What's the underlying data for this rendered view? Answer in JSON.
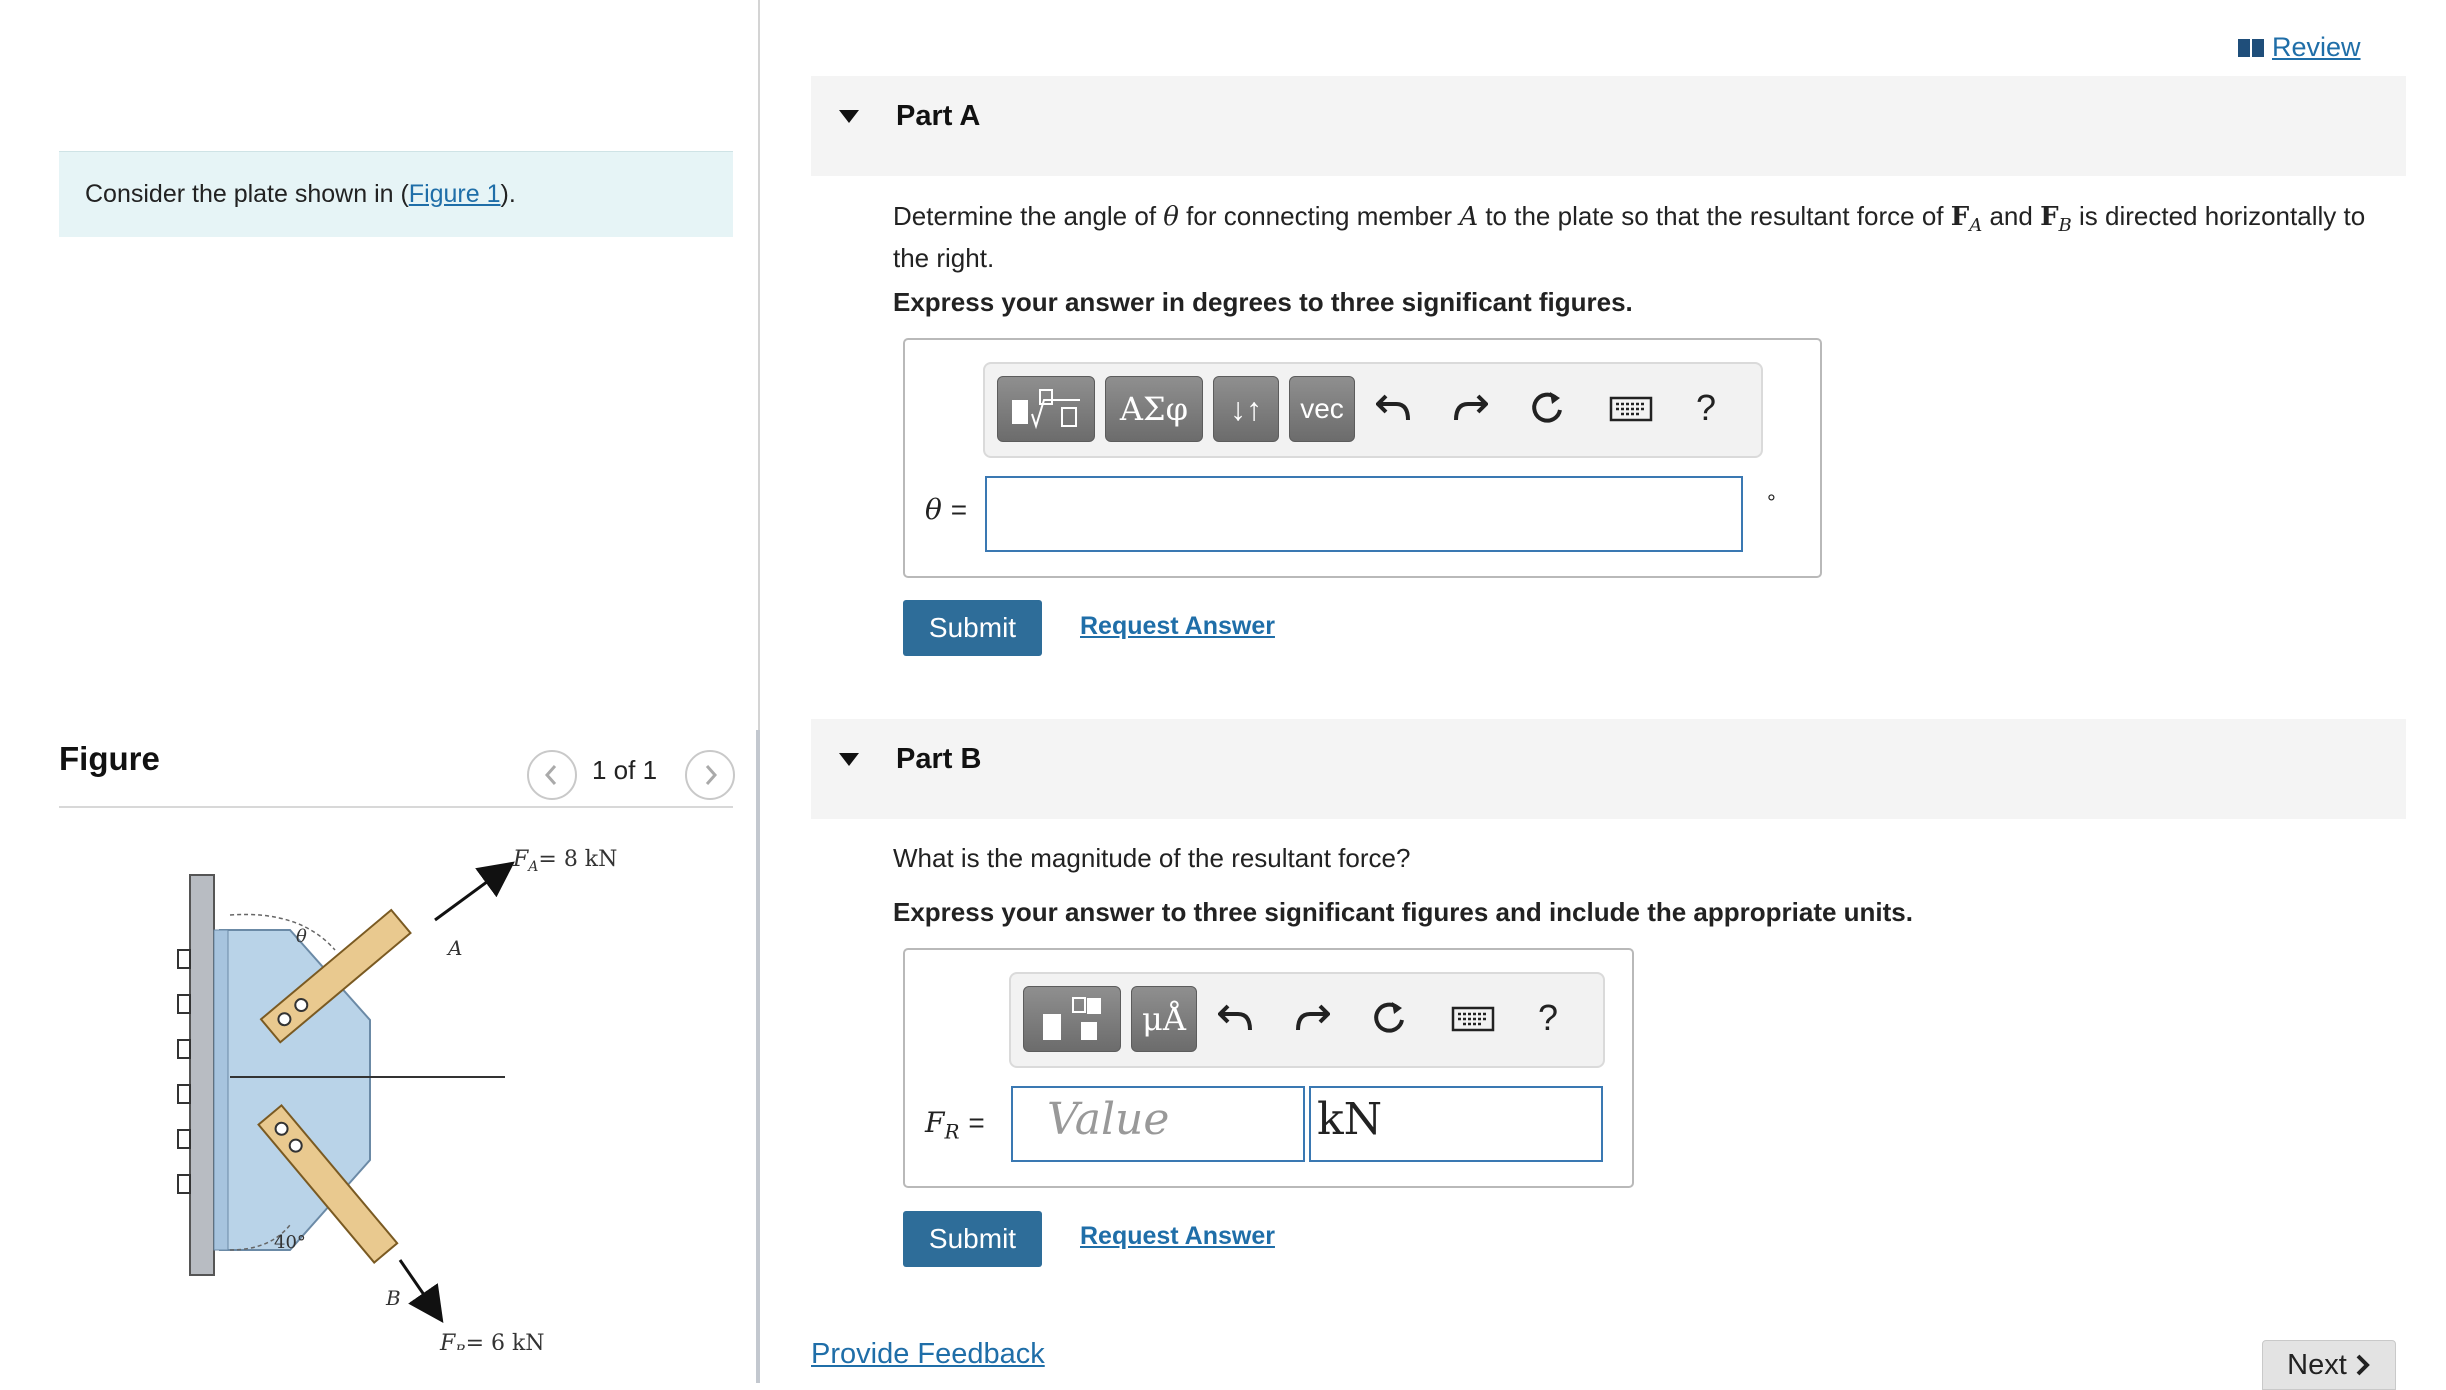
{
  "left": {
    "intro_prefix": "Consider the plate shown in (",
    "intro_link": "Figure 1",
    "intro_suffix": ").",
    "figure_title": "Figure",
    "figure_count": "1 of 1",
    "figure": {
      "fa_label": "F",
      "fa_sub": "A",
      "fa_value": "= 8 kN",
      "fb_label": "F",
      "fb_sub": "B",
      "fb_value": "= 6 kN",
      "theta": "θ",
      "angle_b": "40°",
      "member_a": "A",
      "member_b": "B"
    }
  },
  "header": {
    "review_label": "Review"
  },
  "part_a": {
    "title": "Part A",
    "question_1": "Determine the angle of",
    "question_theta": "θ",
    "question_2": "for connecting member",
    "question_A": "A",
    "question_3": "to the plate so that the resultant force of",
    "question_FA": "F",
    "question_FA_sub": "A",
    "question_4": "and",
    "question_FB": "F",
    "question_FB_sub": "B",
    "question_5": "is directed horizontally to",
    "question_6": "the right.",
    "instruction": "Express your answer in degrees to three significant figures.",
    "tool_greek": "ΑΣφ",
    "tool_arrows": "↓↑",
    "tool_vec": "vec",
    "tool_help": "?",
    "var_label": "θ",
    "eq": "=",
    "unit": "°",
    "submit": "Submit",
    "request": "Request Answer"
  },
  "part_b": {
    "title": "Part B",
    "question": "What is the magnitude of the resultant force?",
    "instruction": "Express your answer to three significant figures and include the appropriate units.",
    "tool_units": "μÅ",
    "tool_help": "?",
    "var_label": "F",
    "var_sub": "R",
    "eq": "=",
    "value_placeholder": "Value",
    "unit_value": "kN",
    "submit": "Submit",
    "request": "Request Answer"
  },
  "footer": {
    "feedback": "Provide Feedback",
    "next": "Next"
  }
}
